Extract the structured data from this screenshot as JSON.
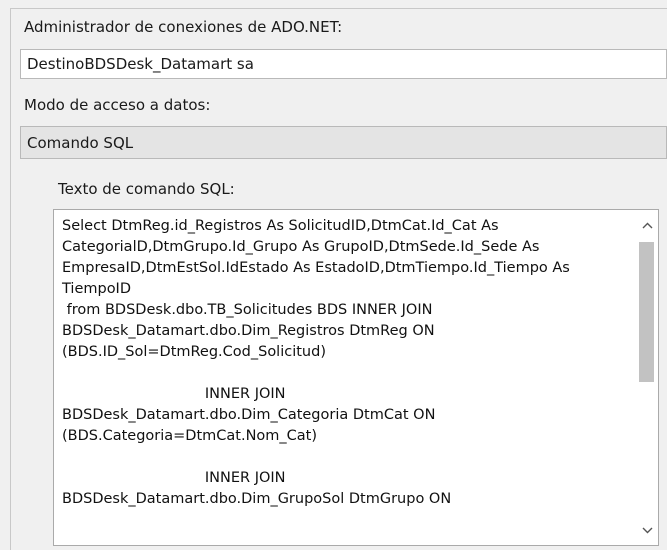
{
  "connection_manager": {
    "label": "Administrador de conexiones de ADO.NET:",
    "value": "DestinoBDSDesk_Datamart sa"
  },
  "data_access_mode": {
    "label": "Modo de acceso a datos:",
    "selected": "Comando SQL"
  },
  "sql_command": {
    "label": "Texto de comando SQL:",
    "lines": [
      "Select DtmReg.id_Registros As SolicitudID,DtmCat.Id_Cat As",
      "CategorialD,DtmGrupo.Id_Grupo As GrupoID,DtmSede.Id_Sede As",
      "EmpresaID,DtmEstSol.IdEstado As EstadoID,DtmTiempo.Id_Tiempo As",
      "TiempoID",
      " from BDSDesk.dbo.TB_Solicitudes BDS INNER JOIN",
      "BDSDesk_Datamart.dbo.Dim_Registros DtmReg ON",
      "(BDS.ID_Sol=DtmReg.Cod_Solicitud)",
      "",
      "                               INNER JOIN",
      "BDSDesk_Datamart.dbo.Dim_Categoria DtmCat ON",
      "(BDS.Categoria=DtmCat.Nom_Cat)",
      "",
      "                               INNER JOIN",
      "BDSDesk_Datamart.dbo.Dim_GrupoSol DtmGrupo ON"
    ]
  },
  "icons": {
    "scroll_up": "chevron-up-icon",
    "scroll_down": "chevron-down-icon"
  },
  "colors": {
    "background": "#f0f0f0",
    "combo_background": "#e4e4e4",
    "scroll_thumb": "#c2c2c2"
  }
}
